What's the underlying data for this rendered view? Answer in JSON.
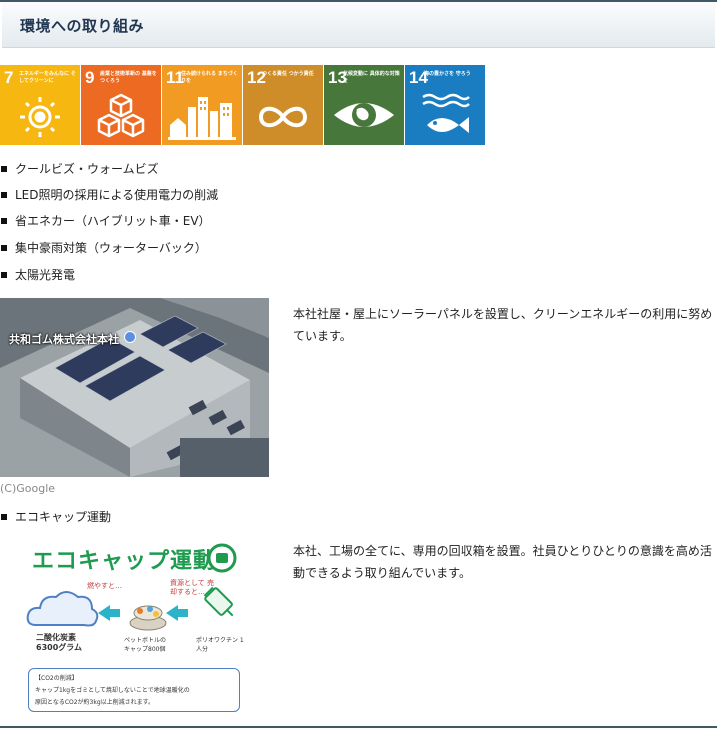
{
  "header": {
    "title": "環境への取り組み"
  },
  "sdgs": [
    {
      "num": "7",
      "caption": "エネルギーをみんなに そしてクリーンに",
      "color": "#f6b711",
      "icon": "sun-icon"
    },
    {
      "num": "9",
      "caption": "産業と技術革新の 基盤をつくろう",
      "color": "#ec6a21",
      "icon": "cubes-icon"
    },
    {
      "num": "11",
      "caption": "住み続けられる まちづくりを",
      "color": "#f29b23",
      "icon": "city-icon"
    },
    {
      "num": "12",
      "caption": "つくる責任 つかう責任",
      "color": "#cf8d2a",
      "icon": "infinity-icon"
    },
    {
      "num": "13",
      "caption": "気候変動に 具体的な対策を",
      "color": "#48773c",
      "icon": "eye-globe-icon"
    },
    {
      "num": "14",
      "caption": "海の豊かさを 守ろう",
      "color": "#1b7dc1",
      "icon": "fish-icon"
    }
  ],
  "list": [
    "クールビズ・ウォームビズ",
    "LED照明の採用による使用電力の削減",
    "省エネカー（ハイブリット車・EV）",
    "集中豪雨対策（ウォーターバック）",
    "太陽光発電"
  ],
  "solar": {
    "photo_label": "共和ゴム株式会社本社",
    "credit": "(C)Google",
    "text": "本社社屋・屋上にソーラーパネルを設置し、クリーンエネルギーの利用に努めています。"
  },
  "ecocap": {
    "list_item": "エコキャップ運動",
    "text": "本社、工場の全てに、専用の回収箱を設置。社員ひとりひとりの意識を高め活動できるよう取り組んでいます。",
    "image": {
      "title": "エコキャップ運動",
      "burn_label": "燃やすと…",
      "resource_label": "資源として 売却すると…",
      "co2_label": "二酸化炭素 6300グラム",
      "bottle_label": "ペットボトルの キャップ800個",
      "vaccine_label": "ポリオワクチン 1人分",
      "box_title": "【CO2の削減】",
      "box_text1": "キャップ1kgをゴミとして焼却しないことで地球温暖化の",
      "box_text2": "原因となるCO2が約3kg以上削減されます。"
    }
  }
}
